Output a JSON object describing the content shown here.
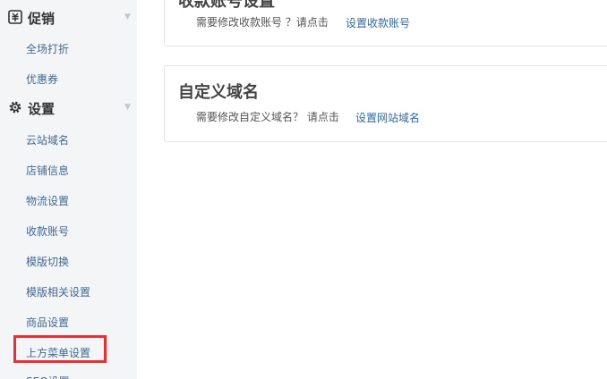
{
  "sidebar": {
    "promo": {
      "title": "促销",
      "icon": "promotion-icon",
      "items": [
        {
          "label": "全场打折"
        },
        {
          "label": "优惠券"
        }
      ]
    },
    "settings": {
      "title": "设置",
      "icon": "gear-icon",
      "items": [
        {
          "label": "云站域名"
        },
        {
          "label": "店铺信息"
        },
        {
          "label": "物流设置"
        },
        {
          "label": "收款账号"
        },
        {
          "label": "模版切换"
        },
        {
          "label": "模版相关设置"
        },
        {
          "label": "商品设置"
        },
        {
          "label": "上方菜单设置"
        },
        {
          "label": "SEO设置"
        }
      ]
    }
  },
  "main": {
    "payment_card": {
      "title": "收款账号设置",
      "desc": "需要修改收款账号 ？请点击",
      "link": "设置收款账号"
    },
    "domain_card": {
      "title": "自定义域名",
      "desc": "需要修改自定义域名？ 请点击",
      "link": "设置网站域名"
    }
  },
  "colors": {
    "link": "#2f6aa8",
    "nav_link": "#3f6a96",
    "highlight": "#ee2d33",
    "sidebar_bg": "#f4f5f7"
  }
}
